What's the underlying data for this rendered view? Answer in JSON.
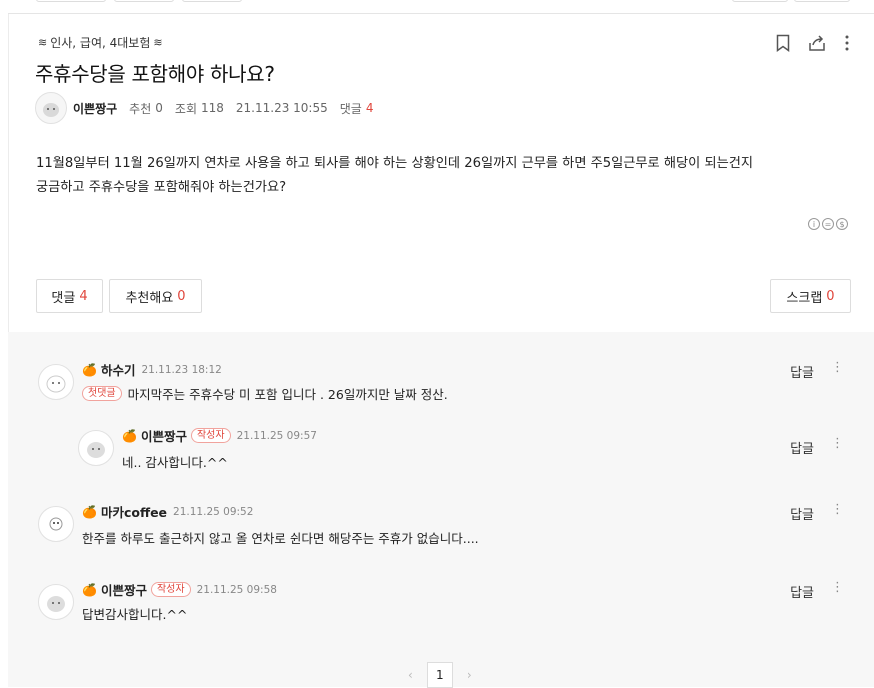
{
  "post": {
    "category": "인사, 급여, 4대보험",
    "title": "주휴수당을 포함해야 하나요?",
    "author": "이쁜짱구",
    "recommend_label": "추천",
    "recommend_count": "0",
    "views_label": "조회",
    "views_count": "118",
    "date": "21.11.23 10:55",
    "comments_label": "댓글",
    "comments_count": "4",
    "body_line1": "11월8일부터 11월 26일까지 연차로 사용을 하고 퇴사를 해야 하는 상황인데 26일까지 근무를 하면 주5일근무로 해당이 되는건지",
    "body_line2": "궁금하고 주휴수당을 포함해줘야 하는건가요?"
  },
  "buttons": {
    "comment_label": "댓글",
    "comment_count": "4",
    "like_label": "추천해요",
    "like_count": "0",
    "scrap_label": "스크랩",
    "scrap_count": "0"
  },
  "comments": [
    {
      "nick": "하수기",
      "time": "21.11.23 18:12",
      "badge": "첫댓글",
      "text": "마지막주는 주휴수당 미 포함 입니다 . 26일까지만 날짜 정산.",
      "reply": "답글"
    },
    {
      "nick": "이쁜짱구",
      "author_tag": "작성자",
      "time": "21.11.25 09:57",
      "text": "네.. 감사합니다.^^",
      "reply": "답글"
    },
    {
      "nick": "마카coffee",
      "time": "21.11.25 09:52",
      "text": "한주를 하루도 출근하지 않고 올 연차로 쉰다면 해당주는 주휴가 없습니다....",
      "reply": "답글"
    },
    {
      "nick": "이쁜짱구",
      "author_tag": "작성자",
      "time": "21.11.25 09:58",
      "text": "답변감사합니다.^^",
      "reply": "답글"
    }
  ],
  "pagination": {
    "current": "1"
  },
  "colors": {
    "accent": "#e0463c",
    "comment_bg": "#f7f7f7"
  },
  "icons": [
    "bookmark-icon",
    "share-icon",
    "more-icon",
    "tangerine-icon",
    "cc-license-icon"
  ]
}
